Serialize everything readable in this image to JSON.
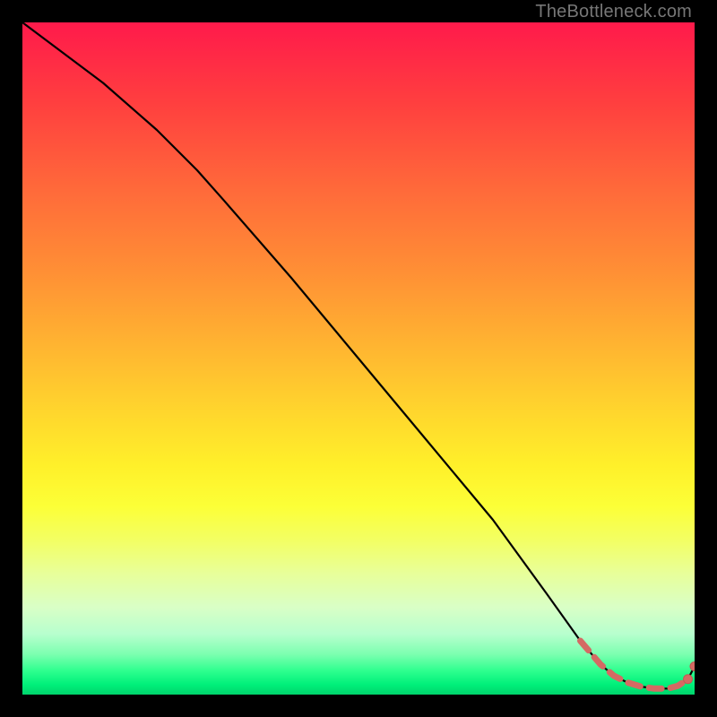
{
  "watermark": "TheBottleneck.com",
  "colors": {
    "curve": "#000000",
    "marker_fill": "#d46a63",
    "marker_stroke": "#c25a54"
  },
  "chart_data": {
    "type": "line",
    "title": "",
    "xlabel": "",
    "ylabel": "",
    "xlim": [
      0,
      100
    ],
    "ylim": [
      0,
      100
    ],
    "grid": false,
    "legend": false,
    "series": [
      {
        "name": "black-curve",
        "x": [
          0,
          12,
          20,
          26,
          30,
          40,
          50,
          60,
          70,
          78,
          83,
          86,
          88,
          90,
          92,
          94,
          96,
          97.5,
          99,
          100
        ],
        "y": [
          100,
          91,
          84,
          78,
          73.5,
          62,
          50,
          38,
          26,
          15,
          8,
          4.5,
          2.8,
          1.8,
          1.2,
          0.9,
          0.9,
          1.3,
          2.3,
          4.2
        ]
      },
      {
        "name": "dashed-floor-tail",
        "x": [
          83,
          86,
          88,
          90,
          92,
          94,
          96,
          97.5,
          99
        ],
        "y": [
          8,
          4.5,
          2.8,
          1.8,
          1.2,
          0.9,
          0.9,
          1.3,
          2.3
        ]
      }
    ],
    "markers": [
      {
        "x": 99,
        "y": 2.3
      },
      {
        "x": 100,
        "y": 4.2
      }
    ]
  }
}
